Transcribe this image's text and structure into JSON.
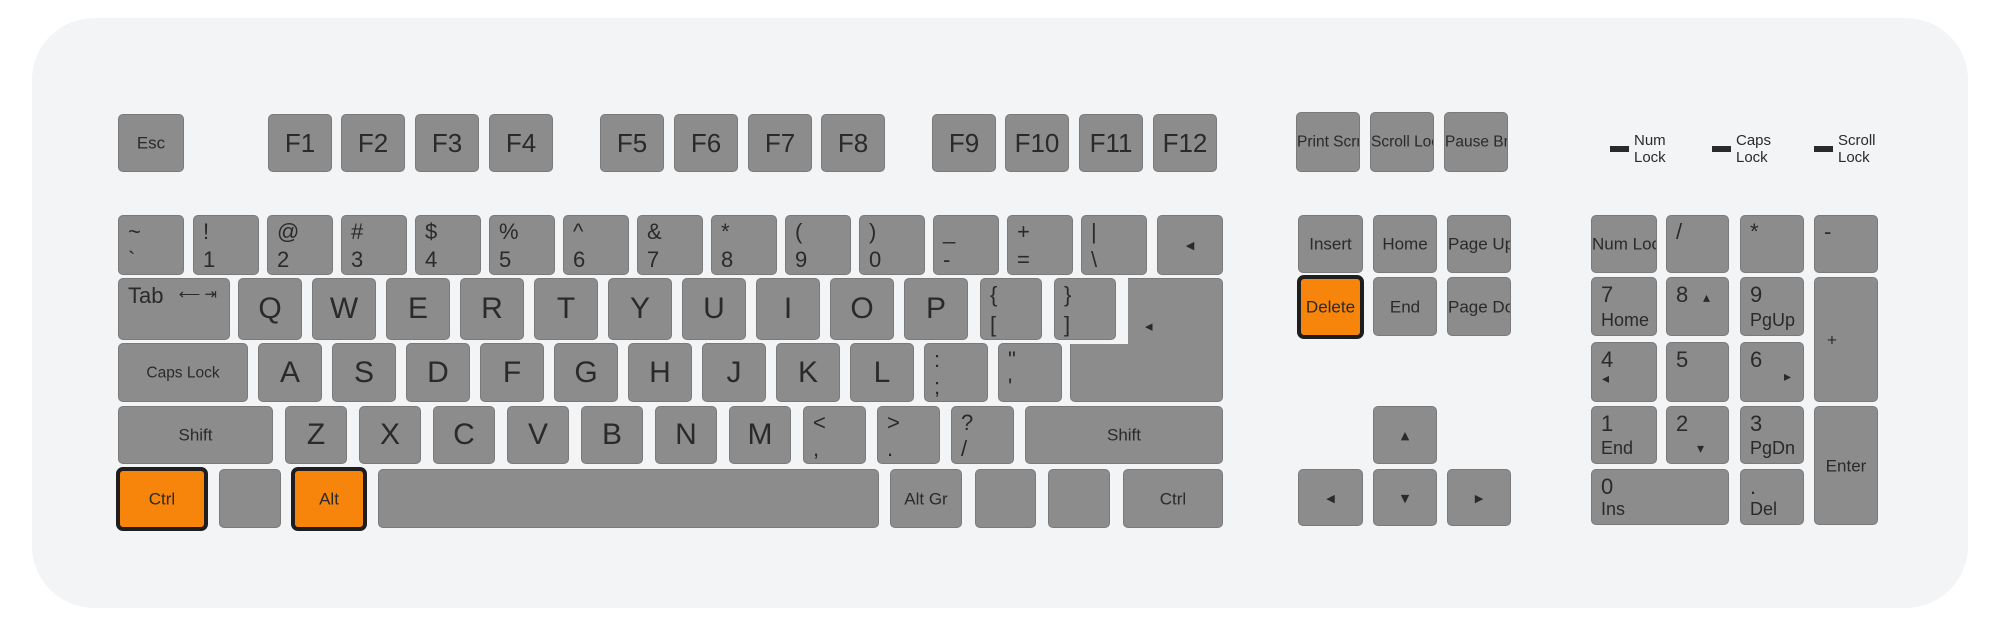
{
  "keyboard": {
    "esc": "Esc",
    "function_keys": [
      "F1",
      "F2",
      "F3",
      "F4",
      "F5",
      "F6",
      "F7",
      "F8",
      "F9",
      "F10",
      "F11",
      "F12"
    ],
    "print_scrn": "Print\nScrn\nSysRq",
    "scroll_lock_key": "Scroll\nLock",
    "pause": "Pause\n\nBreak",
    "indicators": [
      "Num\nLock",
      "Caps\nLock",
      "Scroll\nLock"
    ],
    "number_row": [
      {
        "top": "~",
        "bottom": "`"
      },
      {
        "top": "!",
        "bottom": "1"
      },
      {
        "top": "@",
        "bottom": "2"
      },
      {
        "top": "#",
        "bottom": "3"
      },
      {
        "top": "$",
        "bottom": "4"
      },
      {
        "top": "%",
        "bottom": "5"
      },
      {
        "top": "^",
        "bottom": "6"
      },
      {
        "top": "&",
        "bottom": "7"
      },
      {
        "top": "*",
        "bottom": "8"
      },
      {
        "top": "(",
        "bottom": "9"
      },
      {
        "top": ")",
        "bottom": "0"
      },
      {
        "top": "_",
        "bottom": "-"
      },
      {
        "top": "+",
        "bottom": "="
      },
      {
        "top": "|",
        "bottom": "\\"
      }
    ],
    "backspace_glyph": "◂",
    "tab": "Tab",
    "tab_glyph": "⟵\n⇥",
    "qwerty_row": [
      "Q",
      "W",
      "E",
      "R",
      "T",
      "Y",
      "U",
      "I",
      "O",
      "P"
    ],
    "bracket_keys": [
      {
        "top": "{",
        "bottom": "["
      },
      {
        "top": "}",
        "bottom": "]"
      }
    ],
    "enter_glyph": "◂",
    "caps_lock": "Caps\nLock",
    "home_row": [
      "A",
      "S",
      "D",
      "F",
      "G",
      "H",
      "J",
      "K",
      "L"
    ],
    "quote_keys": [
      {
        "top": ":",
        "bottom": ";"
      },
      {
        "top": "\"",
        "bottom": "'"
      }
    ],
    "shift": "Shift",
    "bottom_row": [
      "Z",
      "X",
      "C",
      "V",
      "B",
      "N",
      "M"
    ],
    "punct_keys": [
      {
        "top": "<",
        "bottom": ","
      },
      {
        "top": ">",
        "bottom": "."
      },
      {
        "top": "?",
        "bottom": "/"
      }
    ],
    "ctrl": "Ctrl",
    "alt": "Alt",
    "alt_gr": "Alt Gr",
    "nav": {
      "insert": "Insert",
      "home": "Home",
      "page_up": "Page\nUp",
      "delete": "Delete",
      "end": "End",
      "page_down": "Page\nDown"
    },
    "arrows": {
      "up": "▴",
      "down": "▾",
      "left": "◂",
      "right": "▸"
    },
    "numpad": {
      "num_lock": "Num\nLock",
      "divide": "/",
      "multiply": "*",
      "minus": "-",
      "plus": "+",
      "enter": "Enter",
      "n7": {
        "top": "7",
        "bottom": "Home"
      },
      "n8": {
        "top": "8",
        "arrow": "▴"
      },
      "n9": {
        "top": "9",
        "bottom": "PgUp"
      },
      "n4": {
        "top": "4",
        "arrow": "◂"
      },
      "n5": {
        "top": "5"
      },
      "n6": {
        "top": "6",
        "arrow": "▸"
      },
      "n1": {
        "top": "1",
        "bottom": "End"
      },
      "n2": {
        "top": "2",
        "arrow": "▾"
      },
      "n3": {
        "top": "3",
        "bottom": "PgDn"
      },
      "n0": {
        "top": "0",
        "bottom": "Ins"
      },
      "dot": {
        "top": ".",
        "bottom": "Del"
      }
    },
    "highlight_color": "#f7850b",
    "key_color": "#8c8c8c"
  }
}
